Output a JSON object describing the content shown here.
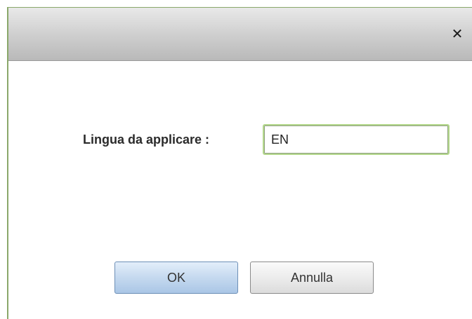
{
  "dialog": {
    "close_icon": "close-icon",
    "close_glyph": "✕",
    "field_label": "Lingua da applicare :",
    "input_value": "EN",
    "ok_label": "OK",
    "cancel_label": "Annulla"
  }
}
